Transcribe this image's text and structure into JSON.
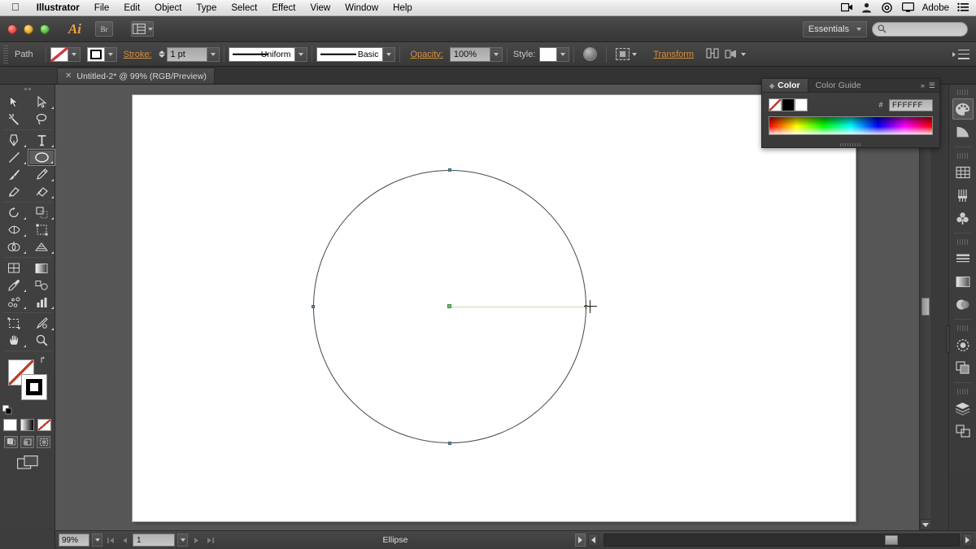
{
  "os_menu": {
    "apple_icon": "apple-icon",
    "items": [
      {
        "label": "Illustrator",
        "bold": true
      },
      {
        "label": "File",
        "bold": false
      },
      {
        "label": "Edit",
        "bold": false
      },
      {
        "label": "Object",
        "bold": false
      },
      {
        "label": "Type",
        "bold": false
      },
      {
        "label": "Select",
        "bold": false
      },
      {
        "label": "Effect",
        "bold": false
      },
      {
        "label": "View",
        "bold": false
      },
      {
        "label": "Window",
        "bold": false
      },
      {
        "label": "Help",
        "bold": false
      }
    ],
    "right_items": [
      {
        "icon": "screen-recording-icon"
      },
      {
        "icon": "user-account-icon"
      },
      {
        "icon": "dropbox-icon"
      },
      {
        "icon": "display-icon"
      }
    ],
    "adobe_label": "Adobe",
    "notification_icon": "notification-list-icon"
  },
  "titlebar": {
    "app_badge": "Ai",
    "bridge_button": "Br",
    "arrange_button": "arrange-documents-icon",
    "workspace_name": "Essentials",
    "search_placeholder": ""
  },
  "control_bar": {
    "selection_label": "Path",
    "fill_swatch": "none",
    "stroke_swatch": "black-square",
    "stroke_label": "Stroke:",
    "stroke_weight": "1 pt",
    "stroke_profile": "Uniform",
    "brush_definition": "Basic",
    "opacity_label": "Opacity:",
    "opacity_value": "100%",
    "style_label": "Style:",
    "style_swatch": "white",
    "recolor_icon": "recolor-artwork-icon",
    "align_icon": "align-icon",
    "transform_link": "Transform",
    "isolate_icon": "isolate-icon",
    "settings_icon": "document-setup-icon",
    "panel_menu_icon": "panel-menu-icon"
  },
  "tab": {
    "close_icon": "close-icon",
    "title": "Untitled-2* @ 99% (RGB/Preview)"
  },
  "toolbar": {
    "tools": [
      {
        "name": "selection-tool",
        "glyph": "arrow-solid",
        "selected": false,
        "corner": false
      },
      {
        "name": "direct-selection-tool",
        "glyph": "arrow-hollow",
        "selected": false,
        "corner": true
      },
      {
        "name": "magic-wand-tool",
        "glyph": "wand",
        "selected": false,
        "corner": false
      },
      {
        "name": "lasso-tool",
        "glyph": "lasso",
        "selected": false,
        "corner": false
      },
      {
        "name": "pen-tool",
        "glyph": "pen",
        "selected": false,
        "corner": true
      },
      {
        "name": "type-tool",
        "glyph": "type",
        "selected": false,
        "corner": true
      },
      {
        "name": "line-segment-tool",
        "glyph": "line",
        "selected": false,
        "corner": true
      },
      {
        "name": "ellipse-tool",
        "glyph": "ellipse",
        "selected": true,
        "corner": true
      },
      {
        "name": "paintbrush-tool",
        "glyph": "brush",
        "selected": false,
        "corner": false
      },
      {
        "name": "pencil-tool",
        "glyph": "pencil",
        "selected": false,
        "corner": true
      },
      {
        "name": "blob-brush-tool",
        "glyph": "blob",
        "selected": false,
        "corner": false
      },
      {
        "name": "eraser-tool",
        "glyph": "eraser",
        "selected": false,
        "corner": true
      },
      {
        "name": "rotate-tool",
        "glyph": "rotate",
        "selected": false,
        "corner": true
      },
      {
        "name": "scale-tool",
        "glyph": "scale",
        "selected": false,
        "corner": true
      },
      {
        "name": "width-tool",
        "glyph": "width",
        "selected": false,
        "corner": true
      },
      {
        "name": "free-transform-tool",
        "glyph": "freetransform",
        "selected": false,
        "corner": false
      },
      {
        "name": "shape-builder-tool",
        "glyph": "shapebuilder",
        "selected": false,
        "corner": true
      },
      {
        "name": "perspective-grid-tool",
        "glyph": "perspective",
        "selected": false,
        "corner": true
      },
      {
        "name": "mesh-tool",
        "glyph": "mesh",
        "selected": false,
        "corner": false
      },
      {
        "name": "gradient-tool",
        "glyph": "gradient",
        "selected": false,
        "corner": false
      },
      {
        "name": "eyedropper-tool",
        "glyph": "eyedropper",
        "selected": false,
        "corner": true
      },
      {
        "name": "blend-tool",
        "glyph": "blend",
        "selected": false,
        "corner": false
      },
      {
        "name": "symbol-sprayer-tool",
        "glyph": "symbolsprayer",
        "selected": false,
        "corner": true
      },
      {
        "name": "column-graph-tool",
        "glyph": "graph",
        "selected": false,
        "corner": true
      },
      {
        "name": "artboard-tool",
        "glyph": "artboard",
        "selected": false,
        "corner": false
      },
      {
        "name": "slice-tool",
        "glyph": "slice",
        "selected": false,
        "corner": true
      },
      {
        "name": "hand-tool",
        "glyph": "hand",
        "selected": false,
        "corner": true
      },
      {
        "name": "zoom-tool",
        "glyph": "zoom",
        "selected": false,
        "corner": false
      }
    ],
    "fill_swatch": "none",
    "stroke_swatch": "black",
    "swap_icon": "swap-fill-stroke-icon",
    "default_icon": "default-fill-stroke-icon",
    "color_modes": [
      {
        "name": "color-mode-button",
        "type": "solid"
      },
      {
        "name": "gradient-mode-button",
        "type": "gradient"
      },
      {
        "name": "none-mode-button",
        "type": "none"
      }
    ],
    "draw_modes": [
      {
        "name": "draw-normal-button"
      },
      {
        "name": "draw-behind-button"
      },
      {
        "name": "draw-inside-button"
      }
    ],
    "screen_mode": "change-screen-mode-button"
  },
  "canvas": {
    "artboard_name": "artboard",
    "shape": "ellipse",
    "anchors": [
      {
        "position": "top"
      },
      {
        "position": "right"
      },
      {
        "position": "bottom"
      },
      {
        "position": "left"
      }
    ],
    "center_point": "center-anchor",
    "smart_guide": "smart-guide-line",
    "cursor": "crosshair-cursor"
  },
  "color_panel": {
    "tabs": [
      {
        "label": "Color",
        "active": true
      },
      {
        "label": "Color Guide",
        "active": false
      }
    ],
    "collapse_icon": "collapse-panel-icon",
    "menu_icon": "panel-menu-icon",
    "swatches": [
      {
        "name": "none-swatch",
        "type": "none"
      },
      {
        "name": "black-swatch",
        "type": "black"
      },
      {
        "name": "white-swatch",
        "type": "white"
      }
    ],
    "hex_symbol": "#",
    "hex_value": "FFFFFF",
    "spectrum": "color-spectrum-ramp"
  },
  "right_dock": {
    "groups": [
      {
        "items": [
          {
            "name": "color-panel-icon",
            "glyph": "palette",
            "active": true
          },
          {
            "name": "color-guide-panel-icon",
            "glyph": "colorguide",
            "active": false
          }
        ]
      },
      {
        "items": [
          {
            "name": "swatches-panel-icon",
            "glyph": "swatches",
            "active": false
          },
          {
            "name": "brushes-panel-icon",
            "glyph": "brushes",
            "active": false
          },
          {
            "name": "symbols-panel-icon",
            "glyph": "symbols",
            "active": false
          }
        ]
      },
      {
        "items": [
          {
            "name": "stroke-panel-icon",
            "glyph": "stroke",
            "active": false
          },
          {
            "name": "gradient-panel-icon",
            "glyph": "gradient",
            "active": false
          },
          {
            "name": "transparency-panel-icon",
            "glyph": "transparency",
            "active": false
          }
        ]
      },
      {
        "items": [
          {
            "name": "appearance-panel-icon",
            "glyph": "appearance",
            "active": false
          },
          {
            "name": "graphic-styles-panel-icon",
            "glyph": "graphicstyles",
            "active": false
          }
        ]
      },
      {
        "items": [
          {
            "name": "layers-panel-icon",
            "glyph": "layers",
            "active": false
          },
          {
            "name": "artboards-panel-icon",
            "glyph": "artboards",
            "active": false
          }
        ]
      }
    ]
  },
  "statusbar": {
    "zoom_value": "99%",
    "first_page_icon": "first-page-icon",
    "prev_page_icon": "prev-page-icon",
    "page_value": "1",
    "next_page_icon": "next-page-icon",
    "last_page_icon": "last-page-icon",
    "status_text": "Ellipse",
    "status_menu_icon": "status-menu-icon"
  },
  "colors": {
    "chrome": "#3e3e3e",
    "canvas": "#565656",
    "accent": "#d98f3b",
    "artboard": "#ffffff",
    "anchor": "#6d8ea6",
    "center": "#6fbf73",
    "guide": "#d9d3a8",
    "stroke": "#3c4a54"
  }
}
